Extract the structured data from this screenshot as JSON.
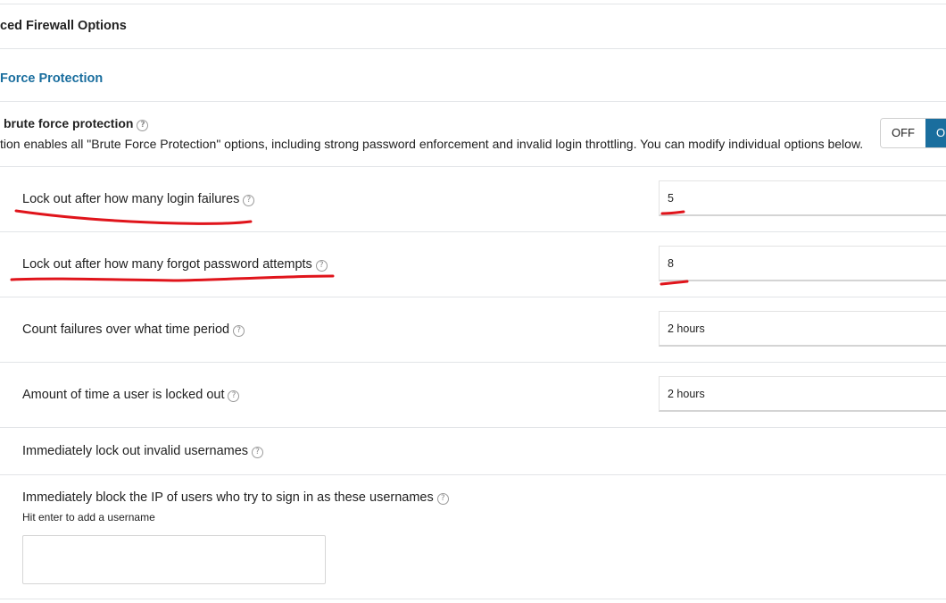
{
  "sections": {
    "advanced": "ced Firewall Options",
    "brute_force": "Force Protection"
  },
  "enable": {
    "label": "brute force protection",
    "description": "tion enables all \"Brute Force Protection\" options, including strong password enforcement and invalid login throttling. You can modify individual options below.",
    "toggle_off": "OFF",
    "toggle_on": "O"
  },
  "help_glyph": "?",
  "options": {
    "login_failures": {
      "label": "Lock out after how many login failures",
      "value": "5"
    },
    "forgot_password": {
      "label": "Lock out after how many forgot password attempts",
      "value": "8"
    },
    "time_period": {
      "label": "Count failures over what time period",
      "value": "2 hours"
    },
    "lockout_time": {
      "label": "Amount of time a user is locked out",
      "value": "2 hours"
    },
    "invalid_usernames": {
      "label": "Immediately lock out invalid usernames"
    },
    "block_usernames": {
      "label": "Immediately block the IP of users who try to sign in as these usernames",
      "hint": "Hit enter to add a username",
      "value": ""
    }
  },
  "colors": {
    "accent": "#1a6e9e",
    "annotation": "#e0141b"
  }
}
